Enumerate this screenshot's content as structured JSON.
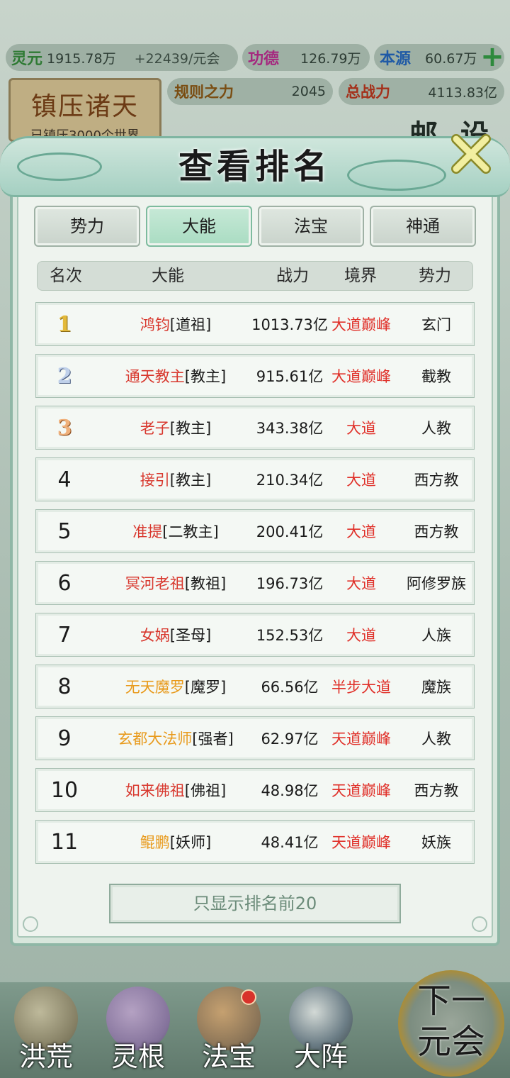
{
  "top_resources": {
    "lingyuan_label": "灵元",
    "lingyuan_value": "1915.78万",
    "lingyuan_rate": "+22439/元会",
    "gongde_label": "功德",
    "gongde_value": "126.79万",
    "benyuan_label": "本源",
    "benyuan_value": "60.67万"
  },
  "stats": {
    "rules_label": "规则之力",
    "rules_value": "2045",
    "total_power_label": "总战力",
    "total_power_value": "4113.83亿"
  },
  "seal": {
    "title": "镇压诸天",
    "subtitle": "已镇压3000个世界"
  },
  "side_buttons": {
    "mail": "邮",
    "settings": "设"
  },
  "modal": {
    "title": "查看排名",
    "tabs": [
      {
        "label": "势力",
        "active": false
      },
      {
        "label": "大能",
        "active": true
      },
      {
        "label": "法宝",
        "active": false
      },
      {
        "label": "神通",
        "active": false
      }
    ],
    "columns": {
      "rank": "名次",
      "name": "大能",
      "power": "战力",
      "realm": "境界",
      "faction": "势力"
    },
    "rows": [
      {
        "rank": "1",
        "name": "鸿钧",
        "title": "[道祖]",
        "name_color": "#d8382e",
        "power": "1013.73亿",
        "realm": "大道巅峰",
        "faction": "玄门"
      },
      {
        "rank": "2",
        "name": "通天教主",
        "title": "[教主]",
        "name_color": "#d8382e",
        "power": "915.61亿",
        "realm": "大道巅峰",
        "faction": "截教"
      },
      {
        "rank": "3",
        "name": "老子",
        "title": "[教主]",
        "name_color": "#d8382e",
        "power": "343.38亿",
        "realm": "大道",
        "faction": "人教"
      },
      {
        "rank": "4",
        "name": "接引",
        "title": "[教主]",
        "name_color": "#d8382e",
        "power": "210.34亿",
        "realm": "大道",
        "faction": "西方教"
      },
      {
        "rank": "5",
        "name": "准提",
        "title": "[二教主]",
        "name_color": "#d8382e",
        "power": "200.41亿",
        "realm": "大道",
        "faction": "西方教"
      },
      {
        "rank": "6",
        "name": "冥河老祖",
        "title": "[教祖]",
        "name_color": "#d8382e",
        "power": "196.73亿",
        "realm": "大道",
        "faction": "阿修罗族"
      },
      {
        "rank": "7",
        "name": "女娲",
        "title": "[圣母]",
        "name_color": "#d8382e",
        "power": "152.53亿",
        "realm": "大道",
        "faction": "人族"
      },
      {
        "rank": "8",
        "name": "无天魔罗",
        "title": "[魔罗]",
        "name_color": "#e89a1c",
        "power": "66.56亿",
        "realm": "半步大道",
        "faction": "魔族"
      },
      {
        "rank": "9",
        "name": "玄都大法师",
        "title": "[强者]",
        "name_color": "#e89a1c",
        "power": "62.97亿",
        "realm": "天道巅峰",
        "faction": "人教"
      },
      {
        "rank": "10",
        "name": "如来佛祖",
        "title": "[佛祖]",
        "name_color": "#d8382e",
        "power": "48.98亿",
        "realm": "天道巅峰",
        "faction": "西方教"
      },
      {
        "rank": "11",
        "name": "鲲鹏",
        "title": "[妖师]",
        "name_color": "#e89a1c",
        "power": "48.41亿",
        "realm": "天道巅峰",
        "faction": "妖族"
      }
    ],
    "filter_button": "只显示排名前20",
    "realm_color": "#e0312a"
  },
  "bottom_nav": [
    {
      "label": "洪荒",
      "icon": "mountain-icon"
    },
    {
      "label": "灵根",
      "icon": "lotus-icon"
    },
    {
      "label": "法宝",
      "icon": "treasure-icon"
    },
    {
      "label": "大阵",
      "icon": "taiji-icon"
    }
  ],
  "next_button": "下一元会"
}
